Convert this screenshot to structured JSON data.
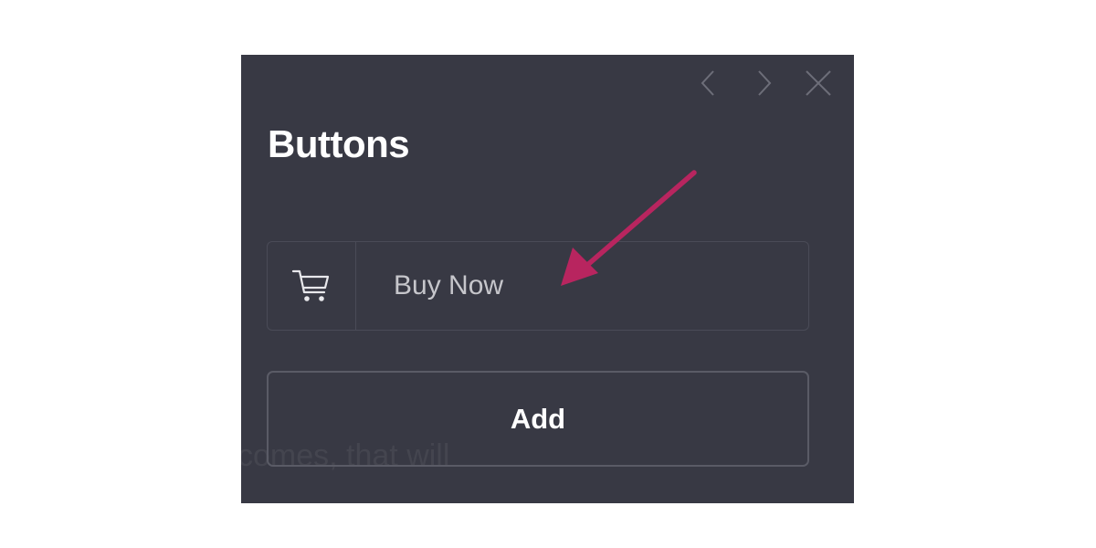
{
  "panel": {
    "title": "Buttons",
    "controls": {
      "prev_icon": "chevron-left-icon",
      "next_icon": "chevron-right-icon",
      "close_icon": "close-icon"
    }
  },
  "button_item": {
    "icon": "shopping-cart-icon",
    "label": "Buy Now"
  },
  "add_button": {
    "label": "Add"
  },
  "background_text": "comes, that will",
  "annotation": {
    "type": "arrow",
    "color": "#b8255f",
    "points_to": "Buy Now"
  },
  "colors": {
    "panel_background": "#383944",
    "page_background": "#ffffff",
    "title_text": "#ffffff",
    "label_text": "#c6c6cb",
    "border": "#4a4b57"
  }
}
